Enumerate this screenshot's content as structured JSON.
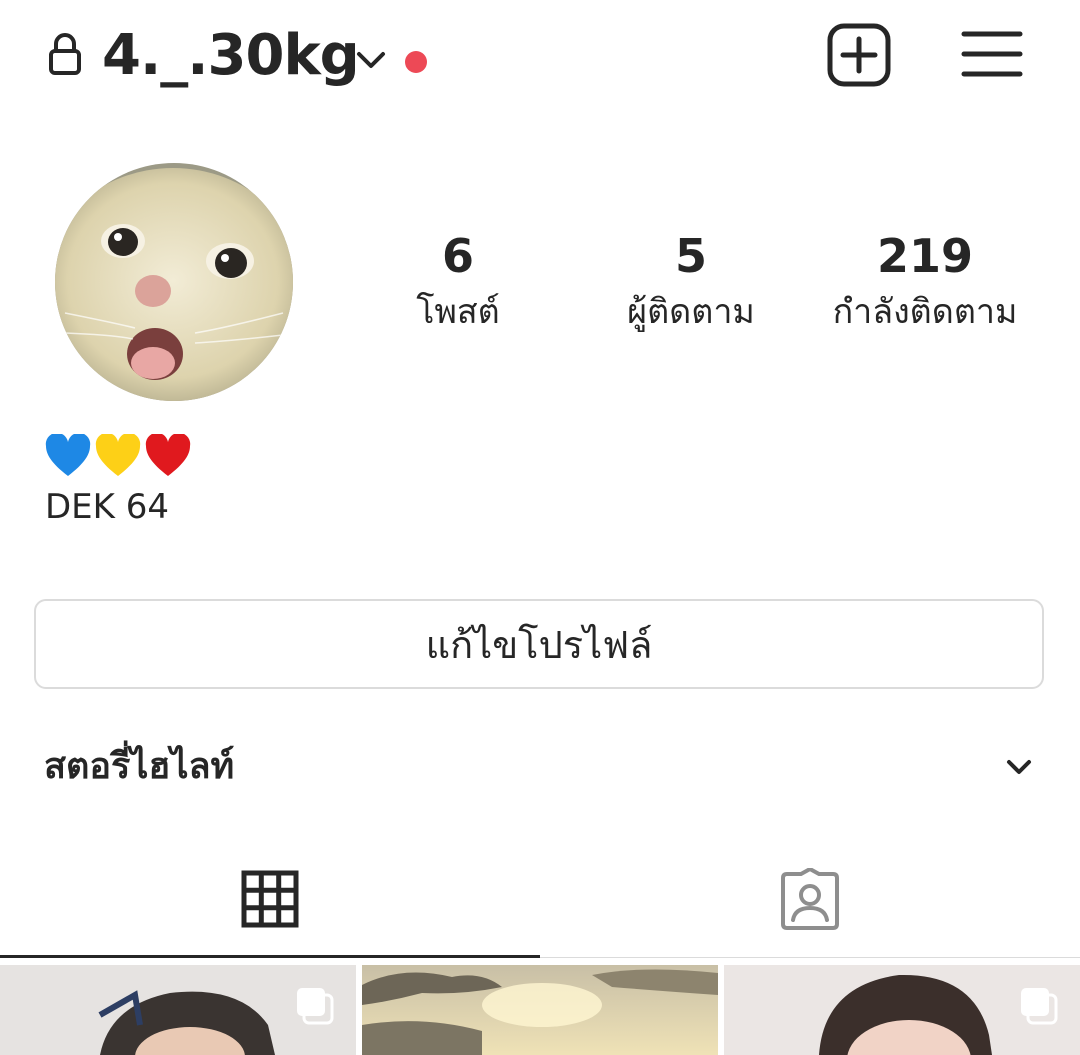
{
  "header": {
    "username": "4._.30kg",
    "icons": {
      "lock": "lock-icon",
      "account_switch": "chevron-down-icon",
      "notification_dot_color": "#ed4956",
      "new_post": "plus-square-icon",
      "menu": "hamburger-menu-icon"
    }
  },
  "profile": {
    "avatar": "cat-avatar",
    "stats": [
      {
        "count": "6",
        "label": "โพสต์"
      },
      {
        "count": "5",
        "label": "ผู้ติดตาม"
      },
      {
        "count": "219",
        "label": "กำลังติดตาม"
      }
    ],
    "bio": {
      "emoji": [
        "💙",
        "💛",
        "❤️"
      ],
      "line": "DEK 64"
    },
    "edit_button_label": "แก้ไขโปรไฟล์"
  },
  "highlights": {
    "title": "สตอรี่ไฮไลท์",
    "toggle_icon": "chevron-down-icon"
  },
  "tabs": [
    {
      "name": "grid",
      "icon": "grid-icon",
      "active": true
    },
    {
      "name": "tagged",
      "icon": "tagged-person-icon",
      "active": false
    }
  ],
  "posts": [
    {
      "type": "photo",
      "multiple": true
    },
    {
      "type": "photo",
      "multiple": false
    },
    {
      "type": "photo",
      "multiple": true
    }
  ]
}
